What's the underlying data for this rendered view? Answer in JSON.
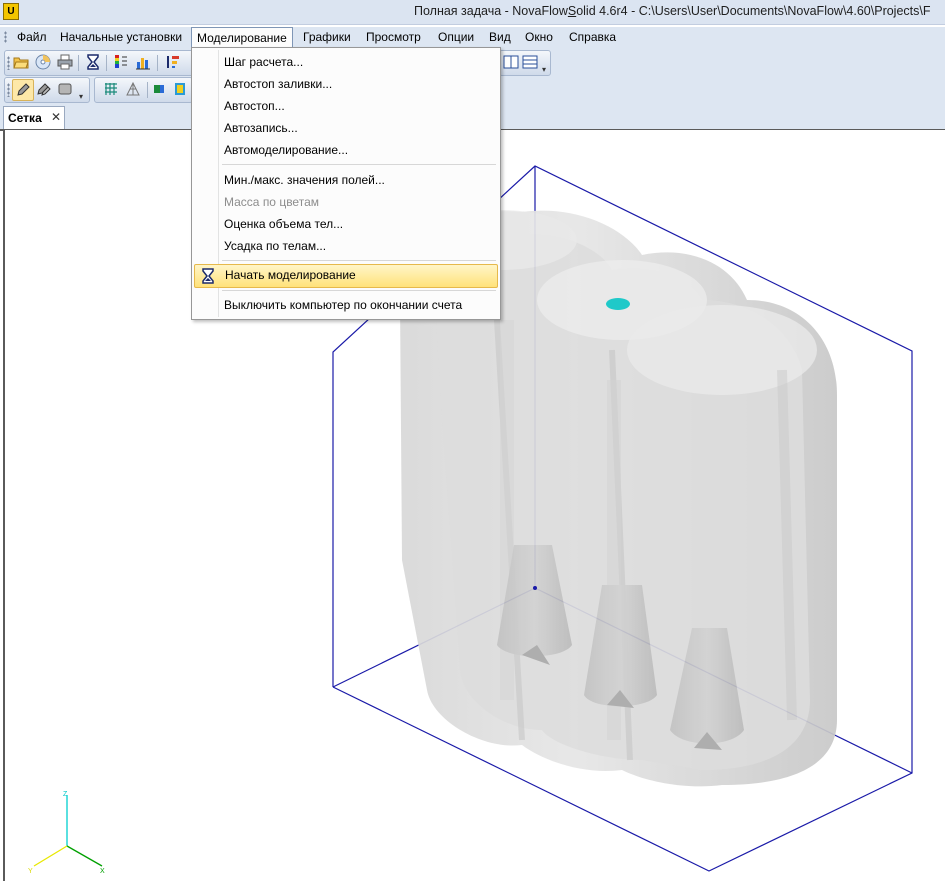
{
  "window": {
    "title_prefix": "Полная задача - NovaFlow",
    "title_underlined": "S",
    "title_suffix": "olid 4.6r4 - C:\\Users\\User\\Documents\\NovaFlow\\4.60\\Projects\\F"
  },
  "menubar": {
    "items": [
      "Файл",
      "Начальные установки",
      "Моделирование",
      "Графики",
      "Просмотр",
      "Опции",
      "Вид",
      "Окно",
      "Справка"
    ],
    "active": "Моделирование"
  },
  "tabs": [
    {
      "label": "Сетка",
      "close": "✕"
    }
  ],
  "dropdown": {
    "items": [
      {
        "label": "Шаг расчета..."
      },
      {
        "label": "Автостоп заливки..."
      },
      {
        "label": "Автостоп..."
      },
      {
        "label": "Автозапись..."
      },
      {
        "label": "Автомоделирование..."
      },
      {
        "label": "Мин./макс. значения полей..."
      },
      {
        "label": "Масса по цветам"
      },
      {
        "label": "Оценка объема тел..."
      },
      {
        "label": "Усадка по телам..."
      },
      {
        "label": "Начать моделирование"
      },
      {
        "label": "Выключить компьютер по окончании счета"
      }
    ]
  },
  "axes": {
    "z": "Z",
    "x": "X",
    "y": "Y"
  },
  "colors": {
    "bounding_box": "#1a1aa8",
    "inlet_marker": "#1fc9c9",
    "highlight": "#ffe27a"
  }
}
